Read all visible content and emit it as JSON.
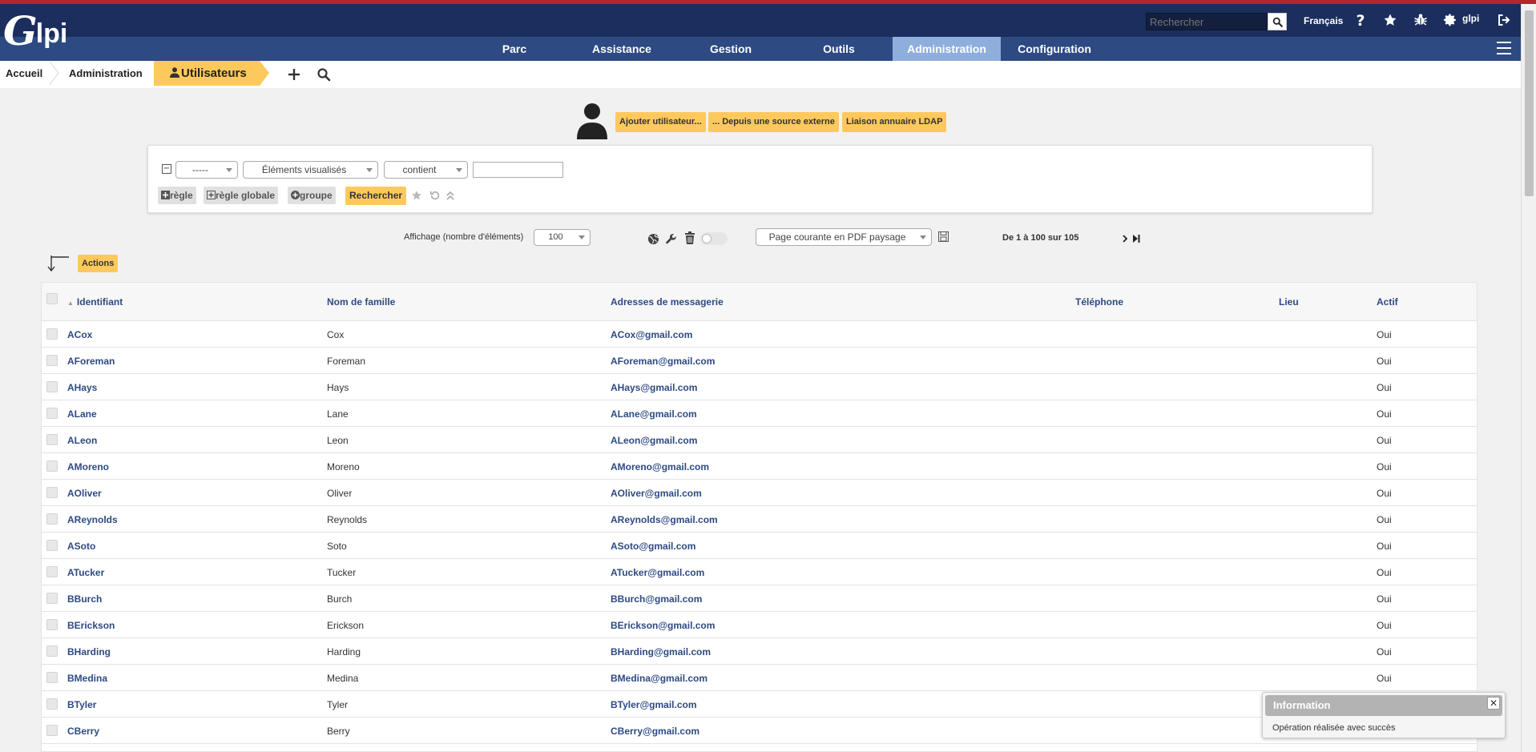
{
  "app": {
    "logo_text": "Glpi",
    "search_placeholder": "Rechercher",
    "language": "Français",
    "user": "glpi"
  },
  "colors": {
    "topbar": "#1b2e5e",
    "menubar": "#2d4a82",
    "active_menu": "#8eaedc",
    "accent": "#fec95c",
    "link": "#2d4a82"
  },
  "menu": {
    "items": [
      {
        "label": "Parc",
        "active": false
      },
      {
        "label": "Assistance",
        "active": false
      },
      {
        "label": "Gestion",
        "active": false
      },
      {
        "label": "Outils",
        "active": false
      },
      {
        "label": "Administration",
        "active": true
      },
      {
        "label": "Configuration",
        "active": false
      }
    ]
  },
  "breadcrumb": {
    "items": [
      "Accueil",
      "Administration",
      "Utilisateurs"
    ]
  },
  "page_actions": {
    "add_user": "Ajouter utilisateur...",
    "external_source": "... Depuis une source externe",
    "ldap": "Liaison annuaire LDAP"
  },
  "search": {
    "field_select": "-----",
    "criteria_select": "Éléments visualisés",
    "operator_select": "contient",
    "value": "",
    "rule_btn": "règle",
    "global_rule_btn": "règle globale",
    "group_btn": "groupe",
    "submit_btn": "Rechercher"
  },
  "list_controls": {
    "display_label": "Affichage (nombre d'éléments)",
    "display_count": "100",
    "export_select": "Page courante en PDF paysage",
    "pagination": "De 1 à 100 sur 105",
    "actions_btn": "Actions"
  },
  "table": {
    "columns": [
      "Identifiant",
      "Nom de famille",
      "Adresses de messagerie",
      "Téléphone",
      "Lieu",
      "Actif"
    ],
    "sort_indicator": "▲",
    "rows": [
      {
        "login": "ACox",
        "lastname": "Cox",
        "email": "ACox@gmail.com",
        "phone": "",
        "location": "",
        "active": "Oui"
      },
      {
        "login": "AForeman",
        "lastname": "Foreman",
        "email": "AForeman@gmail.com",
        "phone": "",
        "location": "",
        "active": "Oui"
      },
      {
        "login": "AHays",
        "lastname": "Hays",
        "email": "AHays@gmail.com",
        "phone": "",
        "location": "",
        "active": "Oui"
      },
      {
        "login": "ALane",
        "lastname": "Lane",
        "email": "ALane@gmail.com",
        "phone": "",
        "location": "",
        "active": "Oui"
      },
      {
        "login": "ALeon",
        "lastname": "Leon",
        "email": "ALeon@gmail.com",
        "phone": "",
        "location": "",
        "active": "Oui"
      },
      {
        "login": "AMoreno",
        "lastname": "Moreno",
        "email": "AMoreno@gmail.com",
        "phone": "",
        "location": "",
        "active": "Oui"
      },
      {
        "login": "AOliver",
        "lastname": "Oliver",
        "email": "AOliver@gmail.com",
        "phone": "",
        "location": "",
        "active": "Oui"
      },
      {
        "login": "AReynolds",
        "lastname": "Reynolds",
        "email": "AReynolds@gmail.com",
        "phone": "",
        "location": "",
        "active": "Oui"
      },
      {
        "login": "ASoto",
        "lastname": "Soto",
        "email": "ASoto@gmail.com",
        "phone": "",
        "location": "",
        "active": "Oui"
      },
      {
        "login": "ATucker",
        "lastname": "Tucker",
        "email": "ATucker@gmail.com",
        "phone": "",
        "location": "",
        "active": "Oui"
      },
      {
        "login": "BBurch",
        "lastname": "Burch",
        "email": "BBurch@gmail.com",
        "phone": "",
        "location": "",
        "active": "Oui"
      },
      {
        "login": "BErickson",
        "lastname": "Erickson",
        "email": "BErickson@gmail.com",
        "phone": "",
        "location": "",
        "active": "Oui"
      },
      {
        "login": "BHarding",
        "lastname": "Harding",
        "email": "BHarding@gmail.com",
        "phone": "",
        "location": "",
        "active": "Oui"
      },
      {
        "login": "BMedina",
        "lastname": "Medina",
        "email": "BMedina@gmail.com",
        "phone": "",
        "location": "",
        "active": "Oui"
      },
      {
        "login": "BTyler",
        "lastname": "Tyler",
        "email": "BTyler@gmail.com",
        "phone": "",
        "location": "",
        "active": ""
      },
      {
        "login": "CBerry",
        "lastname": "Berry",
        "email": "CBerry@gmail.com",
        "phone": "",
        "location": "",
        "active": ""
      }
    ]
  },
  "toast": {
    "title": "Information",
    "message": "Opération réalisée avec succès",
    "close": "✕"
  }
}
